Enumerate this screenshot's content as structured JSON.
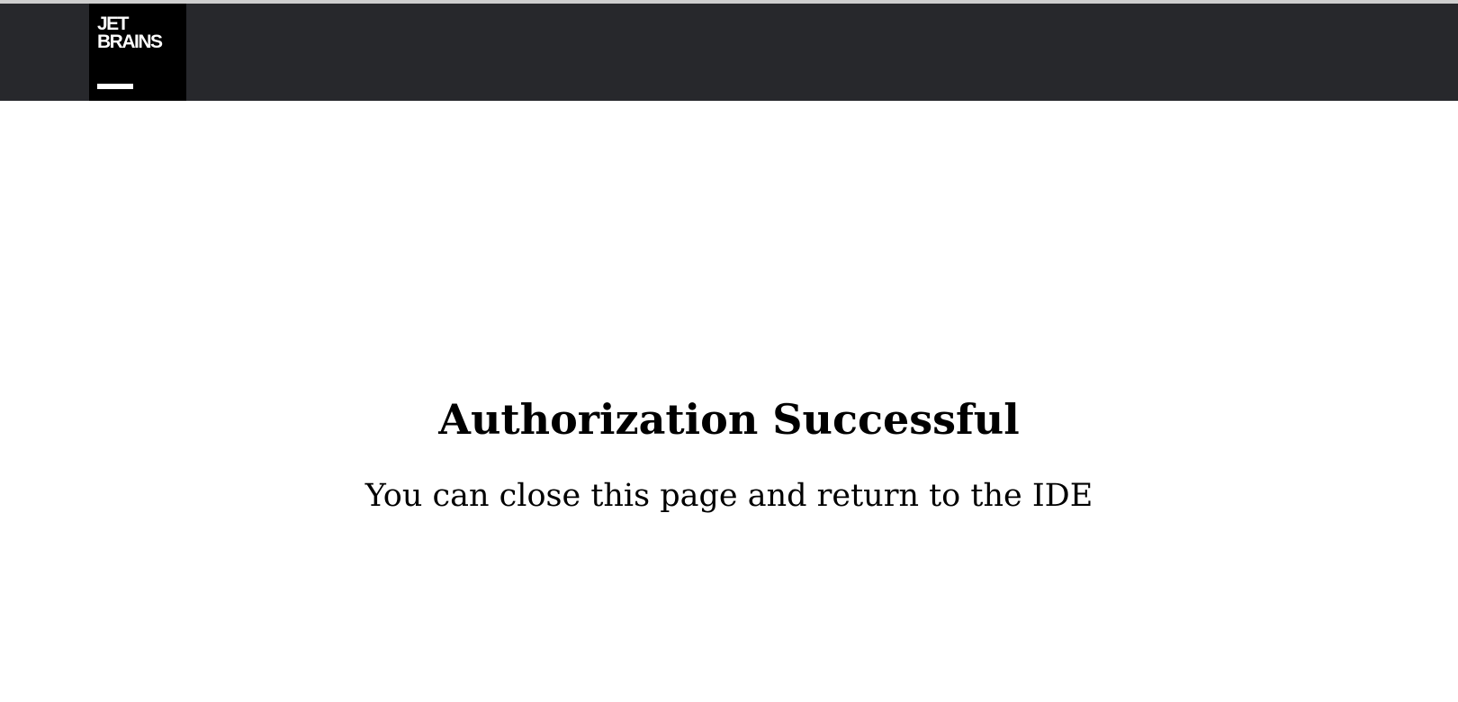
{
  "header": {
    "logo": {
      "line1": "JET",
      "line2": "BRAINS"
    }
  },
  "main": {
    "title": "Authorization Successful",
    "message": "You can close this page and return to the IDE"
  },
  "colors": {
    "header_background": "#27282c",
    "logo_background": "#000000",
    "text": "#000000"
  }
}
